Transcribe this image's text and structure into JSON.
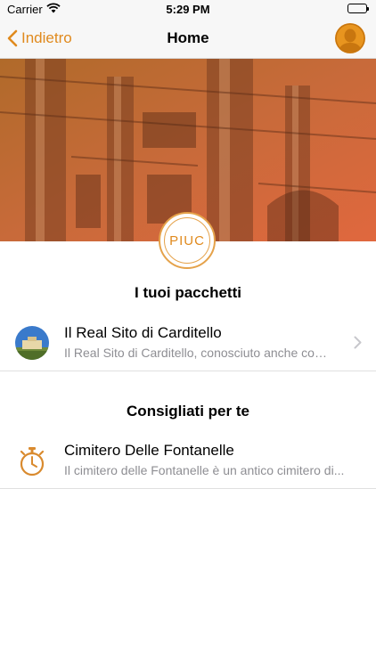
{
  "status_bar": {
    "carrier": "Carrier",
    "time": "5:29 PM"
  },
  "nav": {
    "back_label": "Indietro",
    "title": "Home"
  },
  "colors": {
    "accent": "#e08a1e",
    "hero_top": "#c46a3a",
    "hero_bottom": "#d9663a"
  },
  "hero": {
    "logo_text": "PIUC"
  },
  "packages": {
    "title": "I tuoi pacchetti",
    "items": [
      {
        "title": "Il Real Sito di Carditello",
        "subtitle": "Il Real Sito di Carditello, conosciuto anche come...",
        "icon": "palace-thumbnail"
      }
    ]
  },
  "recommended": {
    "title": "Consigliati per te",
    "items": [
      {
        "title": "Cimitero Delle Fontanelle",
        "subtitle": "Il cimitero delle Fontanelle è un antico cimitero di...",
        "icon": "stopwatch-icon"
      }
    ]
  }
}
